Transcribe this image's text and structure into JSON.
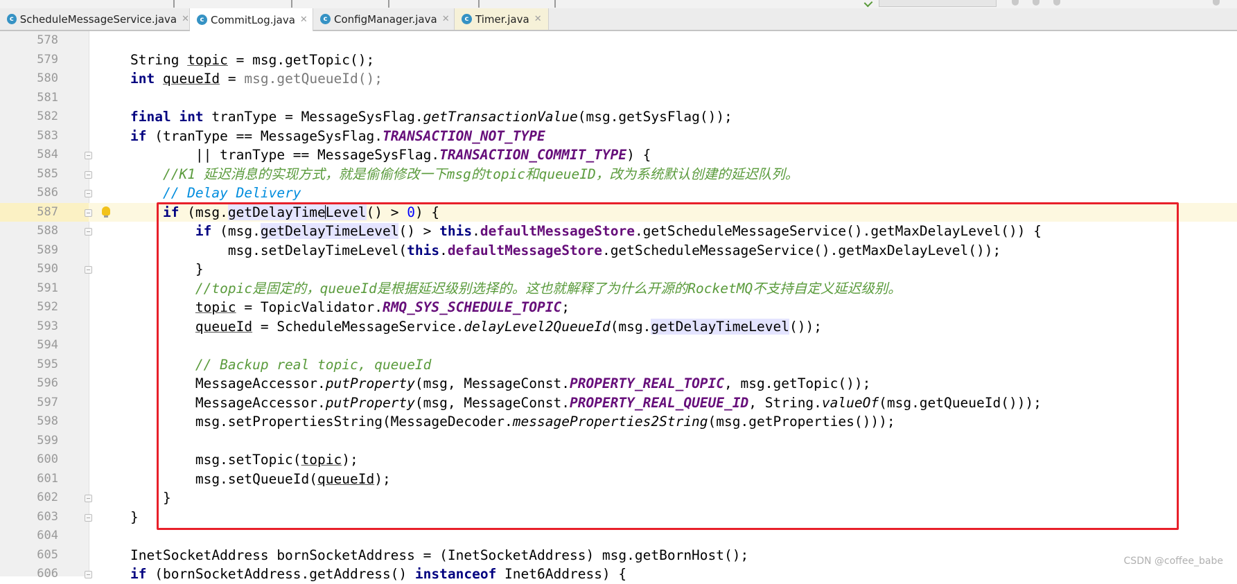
{
  "tabs": [
    {
      "label": "ScheduleMessageService.java",
      "icon": "java-class-icon"
    },
    {
      "label": "CommitLog.java",
      "icon": "java-class-icon",
      "active": true
    },
    {
      "label": "ConfigManager.java",
      "icon": "java-class-icon"
    },
    {
      "label": "Timer.java",
      "icon": "java-class-icon"
    }
  ],
  "colors": {
    "keyword": "#000080",
    "field": "#660e7a",
    "comment_gray": "#808080",
    "comment_todo": "#008dde",
    "comment_cn": "#5a9b3c",
    "number": "#0000ff",
    "annotation_box": "#e8202a",
    "caret_line": "#fdf8e0"
  },
  "editor": {
    "current_line": 587,
    "lines": [
      {
        "no": "578"
      },
      {
        "no": "579",
        "parts": [
          {
            "t": "String "
          },
          {
            "t": "topic",
            "c": "var"
          },
          {
            "t": " = msg.getTopic();"
          }
        ]
      },
      {
        "no": "580",
        "parts": [
          {
            "t": "int",
            "c": "kw"
          },
          {
            "t": " "
          },
          {
            "t": "queueId",
            "c": "var"
          },
          {
            "t": " = "
          },
          {
            "t": "msg.getQueueId();",
            "c": "dim"
          }
        ]
      },
      {
        "no": "581"
      },
      {
        "no": "582",
        "parts": [
          {
            "t": "final",
            "c": "kw"
          },
          {
            "t": " "
          },
          {
            "t": "int",
            "c": "kw"
          },
          {
            "t": " tranType = MessageSysFlag."
          },
          {
            "t": "getTransactionValue",
            "c": "static"
          },
          {
            "t": "(msg.getSysFlag());"
          }
        ]
      },
      {
        "no": "583",
        "parts": [
          {
            "t": "if",
            "c": "kw"
          },
          {
            "t": " (tranType == MessageSysFlag."
          },
          {
            "t": "TRANSACTION_NOT_TYPE",
            "c": "sfield"
          }
        ]
      },
      {
        "no": "584",
        "fold": true,
        "parts": [
          {
            "t": "        || tranType == MessageSysFlag."
          },
          {
            "t": "TRANSACTION_COMMIT_TYPE",
            "c": "sfield"
          },
          {
            "t": ") {"
          }
        ]
      },
      {
        "no": "585",
        "fold": true,
        "parts": [
          {
            "t": "    "
          },
          {
            "t": "//K1 延迟消息的实现方式，就是偷偷修改一下msg的topic和queueID，改为系统默认创建的延迟队列。",
            "c": "cn"
          }
        ]
      },
      {
        "no": "586",
        "fold": true,
        "parts": [
          {
            "t": "    "
          },
          {
            "t": "// Delay Delivery",
            "c": "todo"
          }
        ]
      },
      {
        "no": "587",
        "fold": true,
        "bulb": true,
        "caret": true,
        "parts": [
          {
            "t": "    "
          },
          {
            "t": "if",
            "c": "kw"
          },
          {
            "t": " (msg."
          },
          {
            "t": "getDelayTime",
            "c": "hl"
          },
          {
            "t": "",
            "c": "cursor"
          },
          {
            "t": "Level",
            "c": "hl"
          },
          {
            "t": "() > "
          },
          {
            "t": "0",
            "c": "num"
          },
          {
            "t": ") {"
          }
        ]
      },
      {
        "no": "588",
        "fold": true,
        "parts": [
          {
            "t": "        "
          },
          {
            "t": "if",
            "c": "kw"
          },
          {
            "t": " (msg."
          },
          {
            "t": "getDelayTimeLevel",
            "c": "hl"
          },
          {
            "t": "() > "
          },
          {
            "t": "this",
            "c": "kw"
          },
          {
            "t": "."
          },
          {
            "t": "defaultMessageStore",
            "c": "field"
          },
          {
            "t": ".getScheduleMessageService().getMaxDelayLevel()) {"
          }
        ]
      },
      {
        "no": "589",
        "parts": [
          {
            "t": "            msg.setDelayTimeLevel("
          },
          {
            "t": "this",
            "c": "kw"
          },
          {
            "t": "."
          },
          {
            "t": "defaultMessageStore",
            "c": "field"
          },
          {
            "t": ".getScheduleMessageService().getMaxDelayLevel());"
          }
        ]
      },
      {
        "no": "590",
        "fold": true,
        "parts": [
          {
            "t": "        }"
          }
        ]
      },
      {
        "no": "591",
        "parts": [
          {
            "t": "        "
          },
          {
            "t": "//topic是固定的，queueId是根据延迟级别选择的。这也就解释了为什么开源的RocketMQ不支持自定义延迟级别。",
            "c": "cn"
          }
        ]
      },
      {
        "no": "592",
        "parts": [
          {
            "t": "        "
          },
          {
            "t": "topic",
            "c": "var"
          },
          {
            "t": " = TopicValidator."
          },
          {
            "t": "RMQ_SYS_SCHEDULE_TOPIC",
            "c": "sfield"
          },
          {
            "t": ";"
          }
        ]
      },
      {
        "no": "593",
        "parts": [
          {
            "t": "        "
          },
          {
            "t": "queueId",
            "c": "var"
          },
          {
            "t": " = ScheduleMessageService."
          },
          {
            "t": "delayLevel2QueueId",
            "c": "static"
          },
          {
            "t": "(msg."
          },
          {
            "t": "getDelayTimeLevel",
            "c": "hl"
          },
          {
            "t": "());"
          }
        ]
      },
      {
        "no": "594"
      },
      {
        "no": "595",
        "parts": [
          {
            "t": "        "
          },
          {
            "t": "// Backup real topic, queueId",
            "c": "cn"
          }
        ]
      },
      {
        "no": "596",
        "parts": [
          {
            "t": "        MessageAccessor."
          },
          {
            "t": "putProperty",
            "c": "static"
          },
          {
            "t": "(msg, MessageConst."
          },
          {
            "t": "PROPERTY_REAL_TOPIC",
            "c": "sfield"
          },
          {
            "t": ", msg.getTopic());"
          }
        ]
      },
      {
        "no": "597",
        "parts": [
          {
            "t": "        MessageAccessor."
          },
          {
            "t": "putProperty",
            "c": "static"
          },
          {
            "t": "(msg, MessageConst."
          },
          {
            "t": "PROPERTY_REAL_QUEUE_ID",
            "c": "sfield"
          },
          {
            "t": ", String."
          },
          {
            "t": "valueOf",
            "c": "static"
          },
          {
            "t": "(msg.getQueueId()));"
          }
        ]
      },
      {
        "no": "598",
        "parts": [
          {
            "t": "        msg.setPropertiesString(MessageDecoder."
          },
          {
            "t": "messageProperties2String",
            "c": "static"
          },
          {
            "t": "(msg.getProperties()));"
          }
        ]
      },
      {
        "no": "599"
      },
      {
        "no": "600",
        "parts": [
          {
            "t": "        msg.setTopic("
          },
          {
            "t": "topic",
            "c": "var"
          },
          {
            "t": ");"
          }
        ]
      },
      {
        "no": "601",
        "parts": [
          {
            "t": "        msg.setQueueId("
          },
          {
            "t": "queueId",
            "c": "var"
          },
          {
            "t": ");"
          }
        ]
      },
      {
        "no": "602",
        "fold": true,
        "parts": [
          {
            "t": "    }"
          }
        ]
      },
      {
        "no": "603",
        "fold": true,
        "parts": [
          {
            "t": "}"
          }
        ]
      },
      {
        "no": "604"
      },
      {
        "no": "605",
        "parts": [
          {
            "t": "InetSocketAddress bornSocketAddress = (InetSocketAddress) msg.getBornHost();"
          }
        ]
      },
      {
        "no": "606",
        "fold": true,
        "parts": [
          {
            "t": "if",
            "c": "kw"
          },
          {
            "t": " (bornSocketAddress.getAddress() "
          },
          {
            "t": "instanceof",
            "c": "kw"
          },
          {
            "t": " Inet6Address) {"
          }
        ]
      }
    ]
  },
  "watermark": "CSDN @coffee_babe"
}
